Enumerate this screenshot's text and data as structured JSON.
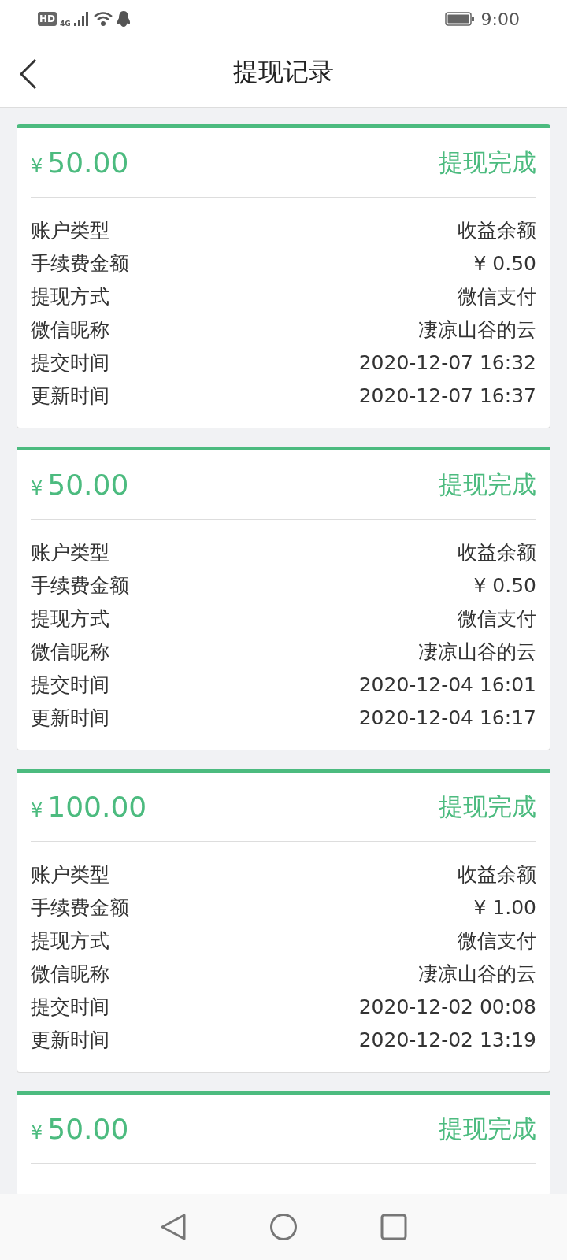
{
  "status_bar": {
    "hd_badge": "HD",
    "network_type": "4G",
    "time": "9:00"
  },
  "header": {
    "title": "提现记录"
  },
  "records": [
    {
      "currency": "¥",
      "amount": "50.00",
      "status": "提现完成",
      "fields": [
        {
          "label": "账户类型",
          "value": "收益余额"
        },
        {
          "label": "手续费金额",
          "value": "¥ 0.50"
        },
        {
          "label": "提现方式",
          "value": "微信支付"
        },
        {
          "label": "微信昵称",
          "value": "凄凉山谷的云"
        },
        {
          "label": "提交时间",
          "value": "2020-12-07 16:32"
        },
        {
          "label": "更新时间",
          "value": "2020-12-07 16:37"
        }
      ]
    },
    {
      "currency": "¥",
      "amount": "50.00",
      "status": "提现完成",
      "fields": [
        {
          "label": "账户类型",
          "value": "收益余额"
        },
        {
          "label": "手续费金额",
          "value": "¥ 0.50"
        },
        {
          "label": "提现方式",
          "value": "微信支付"
        },
        {
          "label": "微信昵称",
          "value": "凄凉山谷的云"
        },
        {
          "label": "提交时间",
          "value": "2020-12-04 16:01"
        },
        {
          "label": "更新时间",
          "value": "2020-12-04 16:17"
        }
      ]
    },
    {
      "currency": "¥",
      "amount": "100.00",
      "status": "提现完成",
      "fields": [
        {
          "label": "账户类型",
          "value": "收益余额"
        },
        {
          "label": "手续费金额",
          "value": "¥ 1.00"
        },
        {
          "label": "提现方式",
          "value": "微信支付"
        },
        {
          "label": "微信昵称",
          "value": "凄凉山谷的云"
        },
        {
          "label": "提交时间",
          "value": "2020-12-02 00:08"
        },
        {
          "label": "更新时间",
          "value": "2020-12-02 13:19"
        }
      ]
    },
    {
      "currency": "¥",
      "amount": "50.00",
      "status": "提现完成"
    }
  ]
}
